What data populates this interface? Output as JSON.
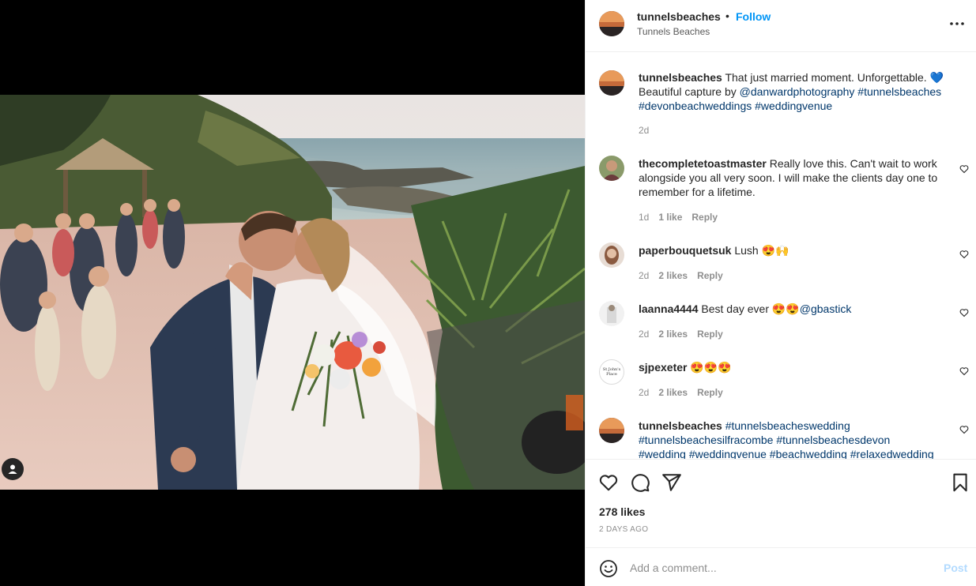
{
  "post": {
    "username": "tunnelsbeaches",
    "follow_label": "Follow",
    "dot": "•",
    "location": "Tunnels Beaches",
    "more_icon": "more-options-icon"
  },
  "caption": {
    "username": "tunnelsbeaches",
    "text_1": "That just married moment. Unforgettable. ",
    "heart": "💙",
    "text_2": "Beautiful capture by ",
    "mention": "@danwardphotography",
    "tags_1": "#tunnelsbeaches",
    "tags_2": "#devonbeachweddings #weddingvenue",
    "time": "2d"
  },
  "comments": [
    {
      "username": "thecompletetoastmaster",
      "text": "Really love this. Can't wait to work alongside you all very soon. I will make the clients day one to remember for a lifetime.",
      "time": "1d",
      "likes": "1 like",
      "reply": "Reply"
    },
    {
      "username": "paperbouquetsuk",
      "text": "Lush 😍🙌",
      "time": "2d",
      "likes": "2 likes",
      "reply": "Reply"
    },
    {
      "username": "laanna4444",
      "text": "Best day ever 😍😍",
      "mention": "@gbastick",
      "time": "2d",
      "likes": "2 likes",
      "reply": "Reply"
    },
    {
      "username": "sjpexeter",
      "text": "😍😍😍",
      "avatar_text": "St John's Place",
      "time": "2d",
      "likes": "2 likes",
      "reply": "Reply"
    },
    {
      "username": "tunnelsbeaches",
      "tags_1": "#tunnelsbeacheswedding",
      "tags_2": "#tunnelsbeachesilfracombe #tunnelsbeachesdevon",
      "tags_3": "#wedding #weddingvenue #beachwedding #relaxedwedding"
    }
  ],
  "actions": {
    "likes": "278 likes",
    "time": "2 DAYS AGO"
  },
  "composer": {
    "placeholder": "Add a comment...",
    "post_label": "Post"
  },
  "colors": {
    "accent": "#0095f6",
    "link": "#00376b",
    "muted": "#8e8e8e",
    "post_disabled": "#b3dbff"
  }
}
